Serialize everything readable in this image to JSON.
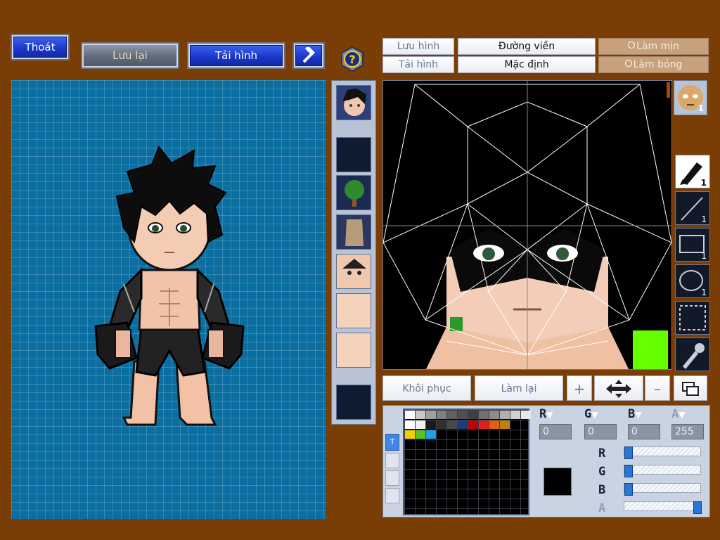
{
  "toolbar": {
    "exit_label": "Thoát",
    "save_label": "Lưu lại",
    "load_label": "Tải hình"
  },
  "editor": {
    "save_image_label": "Lưu hình",
    "load_image_label": "Tải hình",
    "outline_label": "Đường viền",
    "default_label": "Mặc định",
    "smooth_label": "Làm mịn",
    "shade_label": "Làm bóng",
    "restore_label": "Khôi phục",
    "redo_label": "Làm lại",
    "face_badge": "1",
    "tool_badge": "1"
  },
  "color": {
    "r_label": "R",
    "g_label": "G",
    "b_label": "B",
    "a_label": "A",
    "r_value": "0",
    "g_value": "0",
    "b_value": "0",
    "a_value": "255",
    "r": 0,
    "g": 0,
    "b": 0,
    "a": 255,
    "current": "#000000",
    "palette": [
      "#ffffff",
      "#c8c8c8",
      "#a0a0a0",
      "#808080",
      "#606060",
      "#505050",
      "#404040",
      "#707070",
      "#8c8c8c",
      "#b0b0b0",
      "#d0d0d0",
      "#e8e8e8",
      "#ffffff",
      "#f0f0f0",
      "#1a1a1a",
      "#303030",
      "#484848",
      "#1e3c78",
      "#c00000",
      "#e02020",
      "#e06010",
      "#c08010",
      "",
      ""
    ],
    "palette_row3": [
      "#f0d000",
      "#60c020",
      "#20a0e0"
    ]
  },
  "colors": {
    "background": "#7a3d05",
    "canvas": "#0b6ea0",
    "button_blue": "#1a35c8",
    "lime_accent": "#66ff00"
  }
}
